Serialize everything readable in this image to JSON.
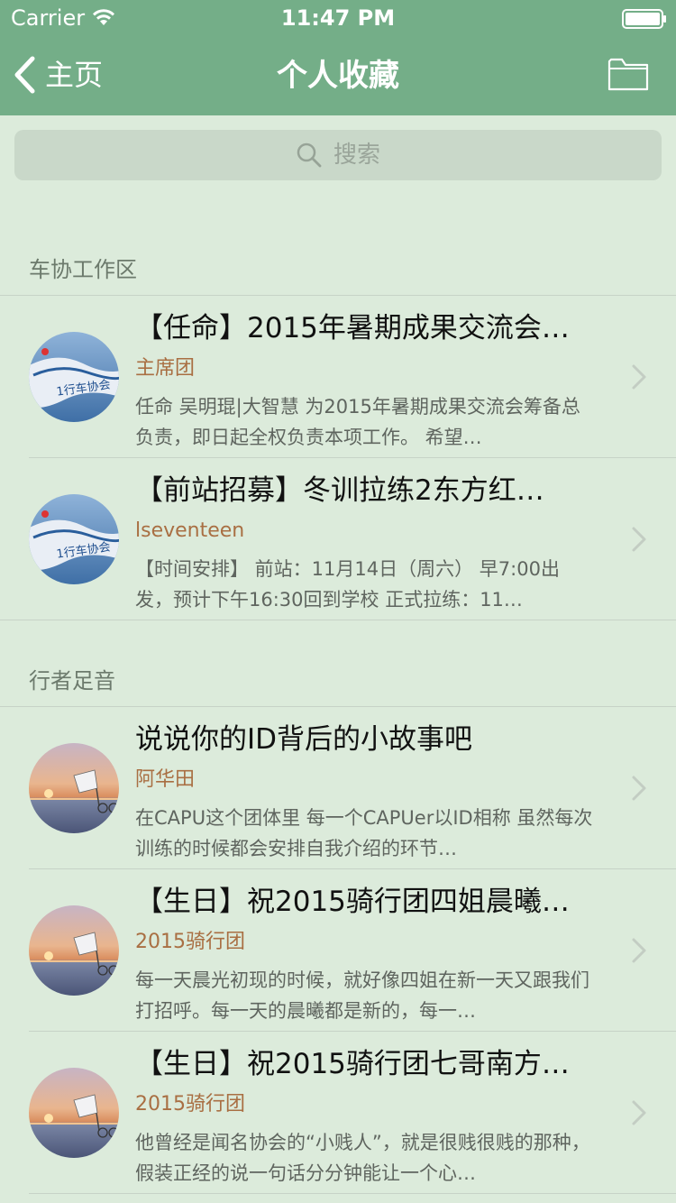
{
  "status_bar": {
    "carrier": "Carrier",
    "time": "11:47 PM",
    "wifi_icon": "wifi-icon",
    "battery_icon": "battery-icon"
  },
  "nav": {
    "back_label": "主页",
    "title": "个人收藏",
    "back_icon": "chevron-left-icon",
    "right_icon": "folder-icon"
  },
  "search": {
    "placeholder": "搜索",
    "icon": "search-icon"
  },
  "colors": {
    "nav_bg": "#74ae88",
    "page_bg": "#dcebdb",
    "author": "#a96f43"
  },
  "sections": [
    {
      "header": "车协工作区",
      "items": [
        {
          "title": "【任命】2015年暑期成果交流会…",
          "author": "主席团",
          "summary": "任命 吴明琨|大智慧 为2015年暑期成果交流会筹备总负责，即日起全权负责本项工作。 希望…",
          "avatar": "bike-club-flag-avatar"
        },
        {
          "title": "【前站招募】冬训拉练2东方红…",
          "author": "lseventeen",
          "summary": "【时间安排】 前站：11月14日（周六） 早7:00出发，预计下午16:30回到学校 正式拉练：11…",
          "avatar": "bike-club-flag-avatar"
        }
      ]
    },
    {
      "header": "行者足音",
      "items": [
        {
          "title": "说说你的ID背后的小故事吧",
          "author": "阿华田",
          "summary": "在CAPU这个团体里 每一个CAPUer以ID相称 虽然每次训练的时候都会安排自我介绍的环节…",
          "avatar": "sunset-bicycle-avatar"
        },
        {
          "title": "【生日】祝2015骑行团四姐晨曦…",
          "author": "2015骑行团",
          "summary": "每一天晨光初现的时候，就好像四姐在新一天又跟我们打招呼。每一天的晨曦都是新的，每一…",
          "avatar": "sunset-bicycle-avatar"
        },
        {
          "title": "【生日】祝2015骑行团七哥南方…",
          "author": "2015骑行团",
          "summary": "他曾经是闻名协会的“小贱人”，就是很贱很贱的那种，假装正经的说一句话分分钟能让一个心…",
          "avatar": "sunset-bicycle-avatar"
        }
      ]
    }
  ]
}
